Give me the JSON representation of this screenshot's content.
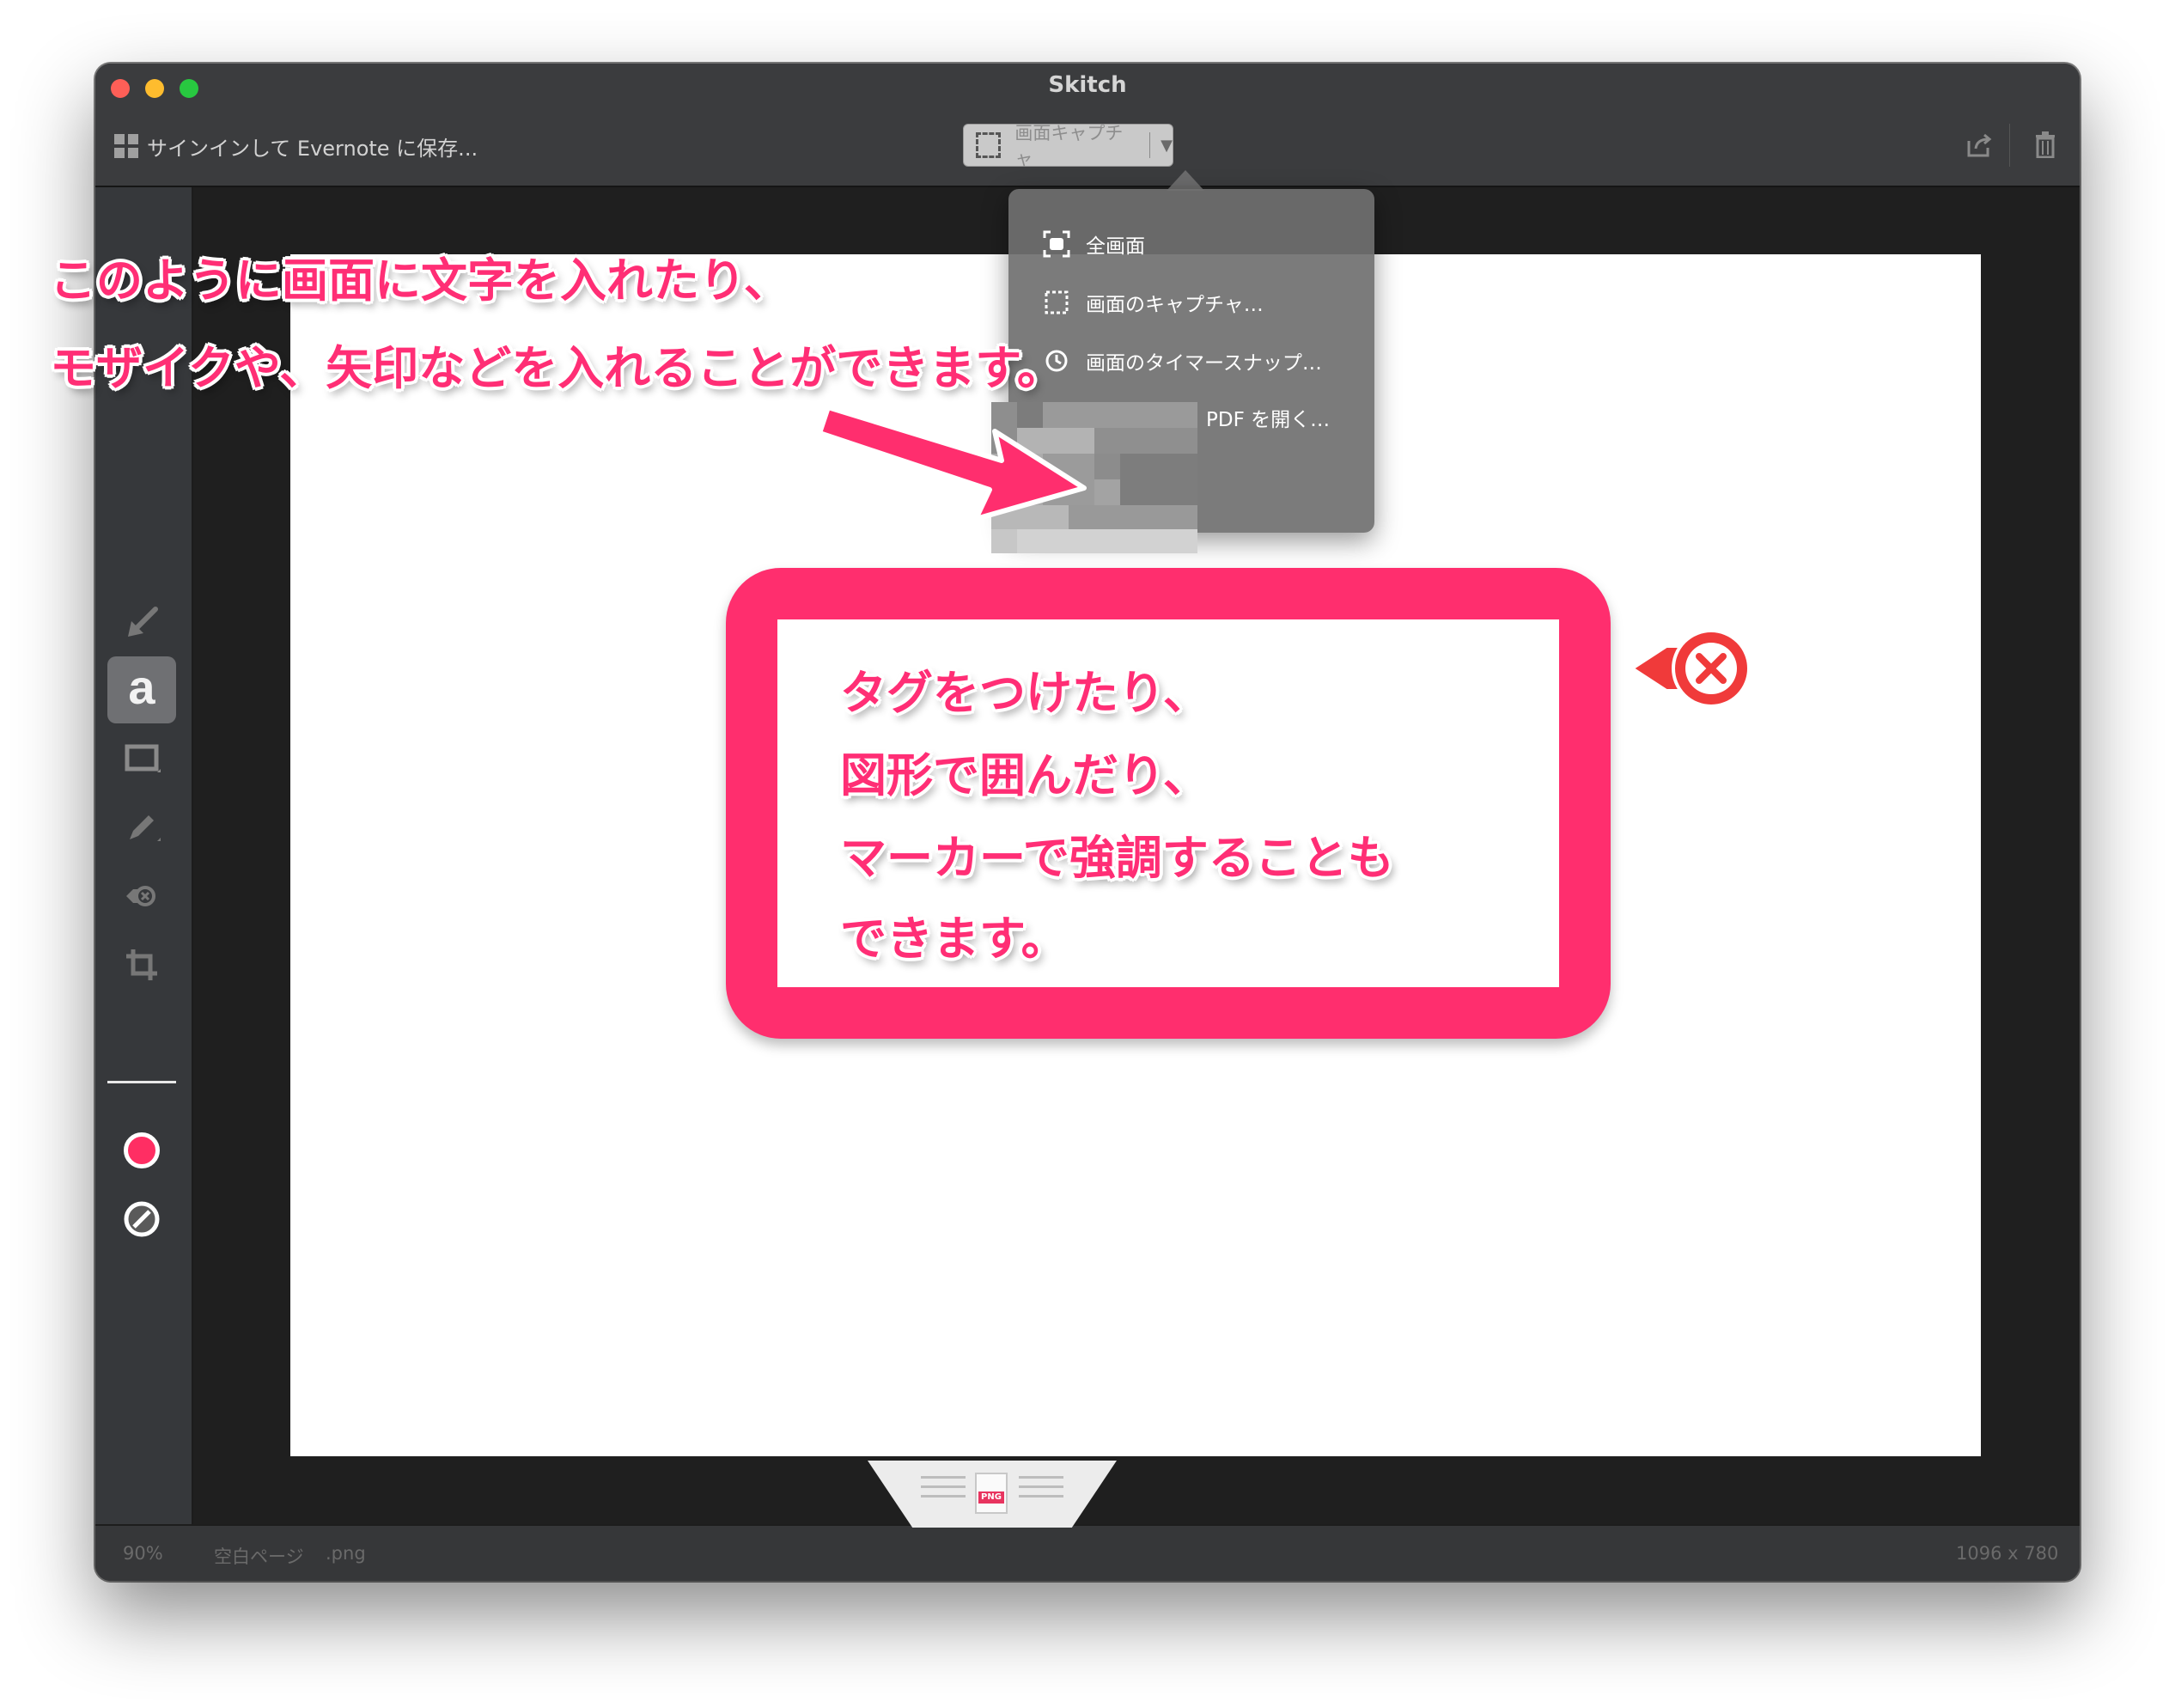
{
  "window": {
    "title": "Skitch"
  },
  "toolbar": {
    "signin_label": "サインインして Evernote に保存...",
    "capture_label": "画面キャプチャ",
    "capture_dropdown_icon": "triangle-down-icon",
    "share_icon": "share-icon",
    "trash_icon": "trash-icon"
  },
  "capture_menu": {
    "items": [
      {
        "label": "全画面",
        "icon": "fullscreen-capture-icon"
      },
      {
        "label": "画面のキャプチャ…",
        "icon": "crosshair-capture-icon"
      },
      {
        "label": "画面のタイマースナップ…",
        "icon": "timer-snap-icon"
      },
      {
        "label": "PDF を開く…",
        "icon": "pdf-icon"
      }
    ]
  },
  "sidebar": {
    "tools": [
      {
        "name": "arrow-tool",
        "icon": "arrow-icon"
      },
      {
        "name": "text-tool",
        "label": "a"
      },
      {
        "name": "shape-tool",
        "icon": "rectangle-icon"
      },
      {
        "name": "pen-tool",
        "icon": "pen-icon"
      },
      {
        "name": "stamp-tool",
        "icon": "stamp-x-icon"
      },
      {
        "name": "crop-tool",
        "icon": "crop-icon"
      }
    ],
    "color": "#ff2e63",
    "stroke_icon": "stroke-width-icon"
  },
  "annotations": {
    "headline_line1": "このように画面に文字を入れたり、",
    "headline_line2": "モザイクや、矢印などを入れることができます。",
    "box_line1": "タグをつけたり、",
    "box_line2": "図形で囲んだり、",
    "box_line3": "マーカーで強調することも",
    "box_line4": "できます。",
    "accent_color": "#ff2e6e"
  },
  "statusbar": {
    "zoom": "90%",
    "document_name": "空白ページ",
    "format": ".png",
    "dimensions": "1096 x 780",
    "drag_tab_label": "PNG"
  }
}
